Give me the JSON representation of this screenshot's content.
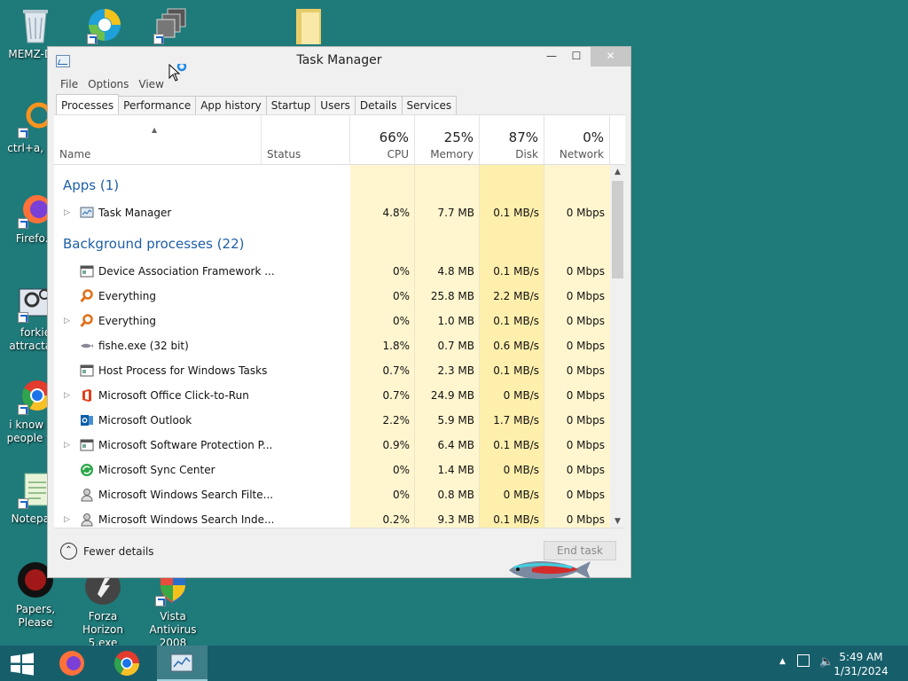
{
  "desktop": {
    "icons": [
      {
        "label": "MEMZ-D..."
      },
      {
        "label": ""
      },
      {
        "label": ""
      },
      {
        "label": ""
      },
      {
        "label": "ctrl+a, e..."
      },
      {
        "label": "Firefo..."
      },
      {
        "label": "forkie attracta..."
      },
      {
        "label": "i know y... people w..."
      },
      {
        "label": "Notepa..."
      },
      {
        "label": "Papers, Please"
      },
      {
        "label": "Forza Horizon 5.exe"
      },
      {
        "label": "Vista Antivirus 2008"
      }
    ]
  },
  "window": {
    "title": "Task Manager",
    "controls": {
      "minimize": "—",
      "maximize": "☐",
      "close": "✕"
    },
    "menu": [
      "File",
      "Options",
      "View"
    ],
    "tabs": [
      "Processes",
      "Performance",
      "App history",
      "Startup",
      "Users",
      "Details",
      "Services"
    ],
    "active_tab": "Processes",
    "columns": {
      "name": "Name",
      "status": "Status",
      "cpu": {
        "pct": "66%",
        "label": "CPU"
      },
      "memory": {
        "pct": "25%",
        "label": "Memory"
      },
      "disk": {
        "pct": "87%",
        "label": "Disk"
      },
      "network": {
        "pct": "0%",
        "label": "Network"
      }
    },
    "groups": {
      "apps": "Apps (1)",
      "background": "Background processes (22)"
    },
    "apps": [
      {
        "name": "Task Manager",
        "cpu": "4.8%",
        "memory": "7.7 MB",
        "disk": "0.1 MB/s",
        "network": "0 Mbps",
        "expandable": true,
        "icon": "task-manager-icon"
      }
    ],
    "background": [
      {
        "name": "Device Association Framework ...",
        "cpu": "0%",
        "memory": "4.8 MB",
        "disk": "0.1 MB/s",
        "network": "0 Mbps",
        "expandable": false,
        "icon": "window-icon"
      },
      {
        "name": "Everything",
        "cpu": "0%",
        "memory": "25.8 MB",
        "disk": "2.2 MB/s",
        "network": "0 Mbps",
        "expandable": false,
        "icon": "magnifier-icon"
      },
      {
        "name": "Everything",
        "cpu": "0%",
        "memory": "1.0 MB",
        "disk": "0.1 MB/s",
        "network": "0 Mbps",
        "expandable": true,
        "icon": "magnifier-icon"
      },
      {
        "name": "fishe.exe (32 bit)",
        "cpu": "1.8%",
        "memory": "0.7 MB",
        "disk": "0.6 MB/s",
        "network": "0 Mbps",
        "expandable": false,
        "icon": "fish-icon"
      },
      {
        "name": "Host Process for Windows Tasks",
        "cpu": "0.7%",
        "memory": "2.3 MB",
        "disk": "0.1 MB/s",
        "network": "0 Mbps",
        "expandable": false,
        "icon": "window-icon"
      },
      {
        "name": "Microsoft Office Click-to-Run",
        "cpu": "0.7%",
        "memory": "24.9 MB",
        "disk": "0 MB/s",
        "network": "0 Mbps",
        "expandable": true,
        "icon": "office-icon"
      },
      {
        "name": "Microsoft Outlook",
        "cpu": "2.2%",
        "memory": "5.9 MB",
        "disk": "1.7 MB/s",
        "network": "0 Mbps",
        "expandable": false,
        "icon": "outlook-icon"
      },
      {
        "name": "Microsoft Software Protection P...",
        "cpu": "0.9%",
        "memory": "6.4 MB",
        "disk": "0.1 MB/s",
        "network": "0 Mbps",
        "expandable": true,
        "icon": "window-icon"
      },
      {
        "name": "Microsoft Sync Center",
        "cpu": "0%",
        "memory": "1.4 MB",
        "disk": "0 MB/s",
        "network": "0 Mbps",
        "expandable": false,
        "icon": "sync-icon"
      },
      {
        "name": "Microsoft Windows Search Filte...",
        "cpu": "0%",
        "memory": "0.8 MB",
        "disk": "0 MB/s",
        "network": "0 Mbps",
        "expandable": false,
        "icon": "search-user-icon"
      },
      {
        "name": "Microsoft Windows Search Inde...",
        "cpu": "0.2%",
        "memory": "9.3 MB",
        "disk": "0.1 MB/s",
        "network": "0 Mbps",
        "expandable": true,
        "icon": "search-user-icon"
      }
    ],
    "footer": {
      "fewer_details": "Fewer details",
      "end_task": "End task"
    }
  },
  "taskbar": {
    "time": "5:49 AM",
    "date": "1/31/2024"
  },
  "colors": {
    "desktop": "#1f7a7a",
    "taskbar": "#175e6b",
    "group_header": "#1e5fa8",
    "heat_light": "#fff4c4",
    "heat_mid": "#ffec9e"
  }
}
